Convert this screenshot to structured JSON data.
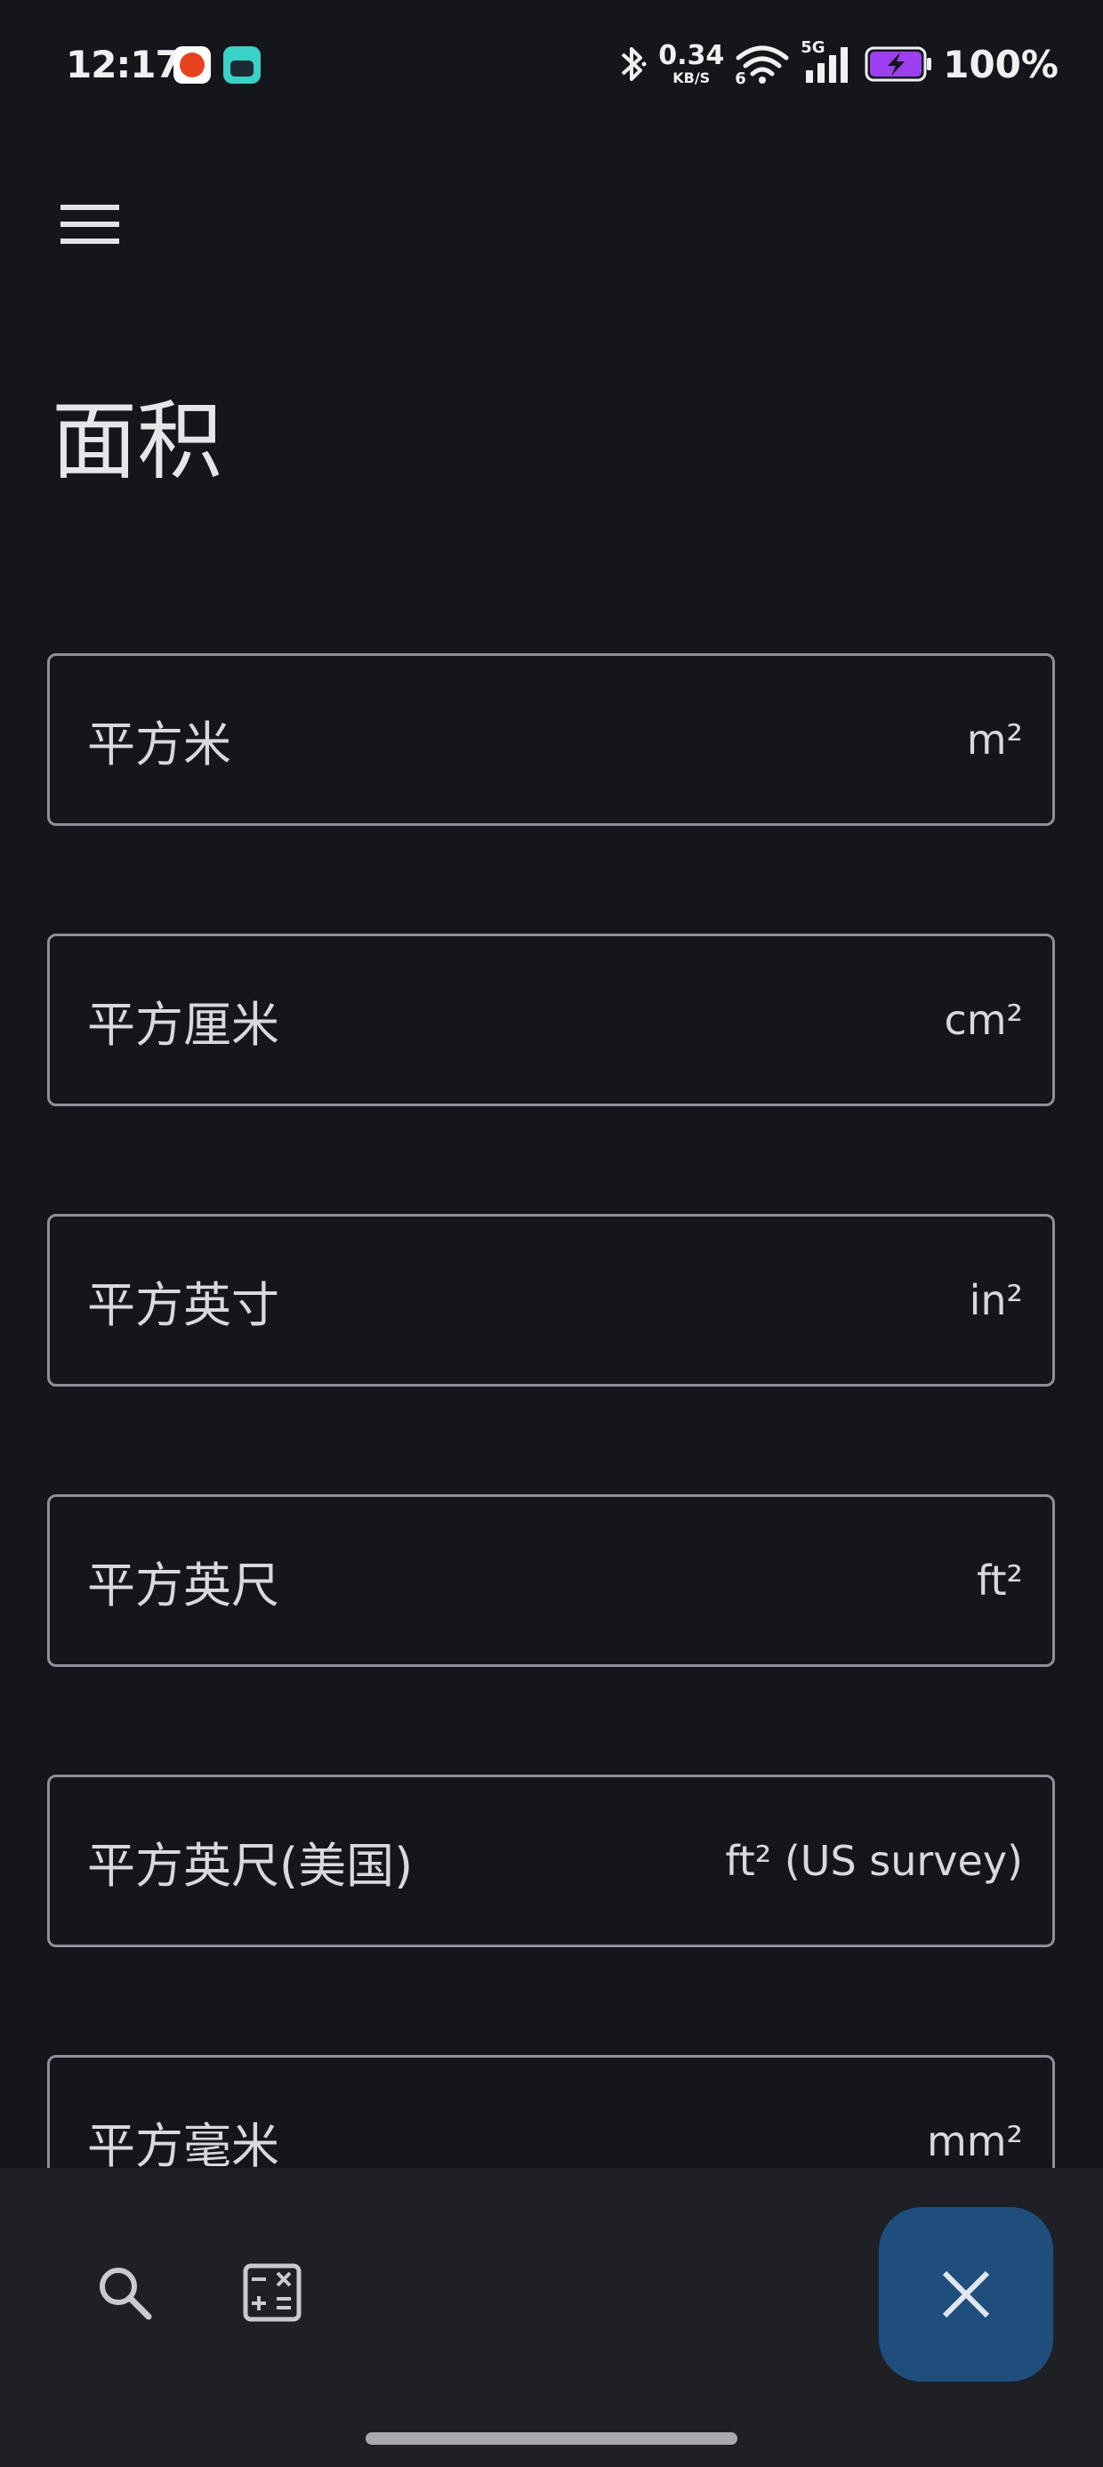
{
  "status_bar": {
    "time": "12:17",
    "net_speed_value": "0.34",
    "net_speed_unit": "KB/S",
    "wifi_sub": "6",
    "network_type": "5G",
    "battery_percent": "100%"
  },
  "header": {
    "title": "面积"
  },
  "units": [
    {
      "label": "平方米",
      "symbol": "m²"
    },
    {
      "label": "平方厘米",
      "symbol": "cm²"
    },
    {
      "label": "平方英寸",
      "symbol": "in²"
    },
    {
      "label": "平方英尺",
      "symbol": "ft²"
    },
    {
      "label": "平方英尺(美国)",
      "symbol": "ft² (US survey)"
    },
    {
      "label": "平方毫米",
      "symbol": "mm²"
    }
  ],
  "bottom_bar": {
    "icons": [
      "search-icon",
      "calculator-icon"
    ],
    "fab_icon": "close-icon"
  },
  "colors": {
    "background": "#14161b",
    "bottom_bar": "#1e2025",
    "fab": "#1f4e7d",
    "outline": "#8e9099",
    "battery_accent": "#9b3ff0"
  }
}
